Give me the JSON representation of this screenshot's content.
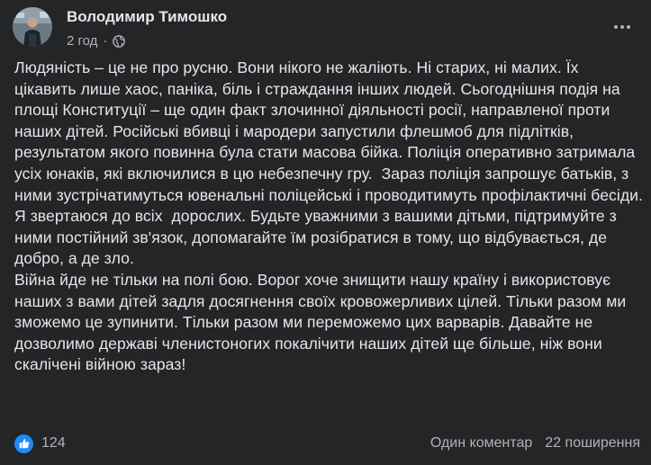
{
  "post": {
    "author": "Володимир Тимошко",
    "time": "2 год",
    "separator": "·",
    "privacy_icon": "globe-icon",
    "more_icon": "more-horizontal-icon",
    "paragraphs": [
      "Людяність – це не про русню. Вони нікого не жаліють. Ні старих, ні малих. Їх цікавить лише хаос, паніка, біль і страждання інших людей. Сьогоднішня подія на площі Конституції – ще один факт злочинної діяльності росії, направленої проти наших дітей. Російські вбивці і мародери запустили флешмоб для підлітків, результатом якого повинна була стати масова бійка. Поліція оперативно затримала усіх юнаків, які включилися в цю небезпечну гру.  Зараз поліція запрошує батьків, з ними зустрічатимуться ювенальні поліцейські і проводитимуть профілактичні бесіди.",
      "Я звертаюся до всіх  дорослих. Будьте уважними з вашими дітьми, підтримуйте з ними постійний зв'язок, допомагайте їм розібратися в тому, що відбувається, де добро, а де зло.",
      "Війна йде не тільки на полі бою. Ворог хоче знищити нашу країну і використовує наших з вами дітей задля досягнення своїх кровожерливих цілей. Тільки разом ми зможемо це зупинити. Тільки разом ми переможемо цих варварів. Давайте не дозволимо державі членистоногих покалічити наших дітей ще більше, ніж вони скалічені війною зараз!"
    ],
    "reactions": {
      "icon": "like-icon",
      "count": "124"
    },
    "comments": "Один коментар",
    "shares": "22 поширення"
  },
  "colors": {
    "background": "#242526",
    "text": "#e4e6eb",
    "secondary_text": "#b0b3b8",
    "like_blue": "#1d8cf8"
  }
}
